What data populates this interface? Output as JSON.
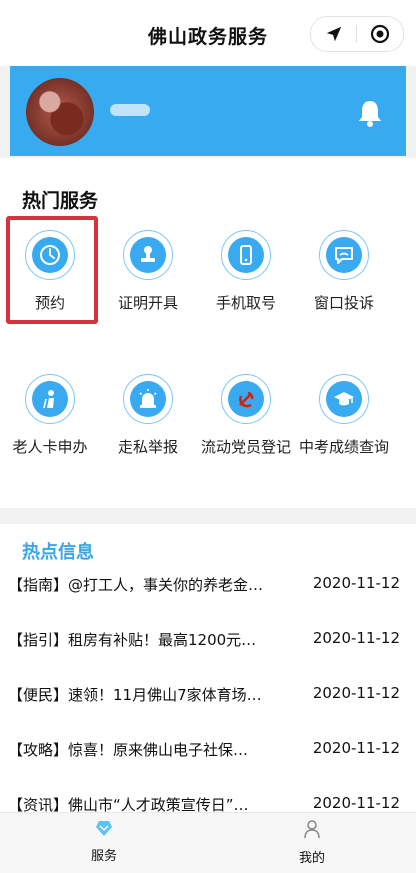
{
  "header": {
    "title": "佛山政务服务"
  },
  "capsule": {
    "left_icon": "location-arrow-icon",
    "right_icon": "record-target-icon"
  },
  "profile": {
    "bell_icon": "bell-icon"
  },
  "hot_services": {
    "title": "热门服务",
    "items": [
      {
        "label": "预约",
        "icon": "clock-icon"
      },
      {
        "label": "证明开具",
        "icon": "stamp-icon"
      },
      {
        "label": "手机取号",
        "icon": "phone-icon"
      },
      {
        "label": "窗口投诉",
        "icon": "chat-bubble-icon"
      },
      {
        "label": "老人卡申办",
        "icon": "elderly-icon"
      },
      {
        "label": "走私举报",
        "icon": "alarm-light-icon"
      },
      {
        "label": "流动党员登记",
        "icon": "party-emblem-icon"
      },
      {
        "label": "中考成绩查询",
        "icon": "graduation-cap-icon"
      }
    ]
  },
  "hot_info": {
    "title": "热点信息",
    "rows": [
      {
        "text": "【指南】@打工人，事关你的养老金…",
        "date": "2020-11-12"
      },
      {
        "text": "【指引】租房有补贴！最高1200元…",
        "date": "2020-11-12"
      },
      {
        "text": "【便民】速领！11月佛山7家体育场…",
        "date": "2020-11-12"
      },
      {
        "text": "【攻略】惊喜！原来佛山电子社保…",
        "date": "2020-11-12"
      },
      {
        "text": "【资讯】佛山市“人才政策宣传日”…",
        "date": "2020-11-12"
      }
    ]
  },
  "tabbar": {
    "tabs": [
      {
        "label": "服务",
        "icon": "heart-diamond-icon"
      },
      {
        "label": "我的",
        "icon": "user-icon"
      }
    ]
  },
  "colors": {
    "accent": "#39aaf0",
    "highlight": "#d9323f",
    "info_title": "#3aa6e6"
  }
}
